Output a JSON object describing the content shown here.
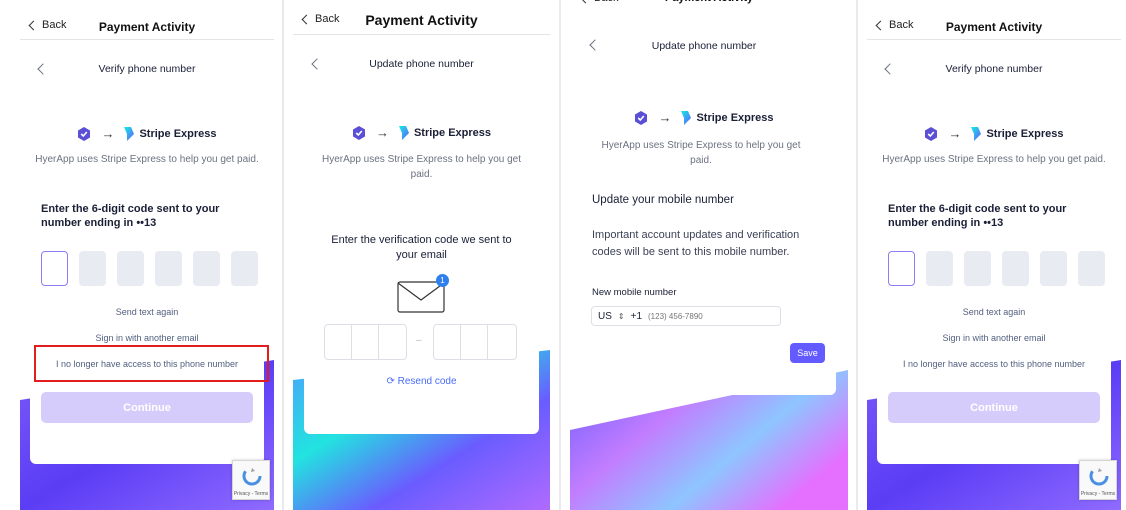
{
  "nav": {
    "back_label": "Back",
    "title": "Payment Activity"
  },
  "brand": {
    "name": "Stripe Express",
    "arrow": "→",
    "description": "HyerApp uses Stripe Express to help you get paid."
  },
  "verify": {
    "title": "Verify phone number",
    "heading": "Enter the 6-digit code sent to your number ending in ••13",
    "send_again": "Send text again",
    "sign_in_other": "Sign in with another email",
    "no_access": "I no longer have access to this phone number",
    "continue_label": "Continue"
  },
  "update_email": {
    "title": "Update phone number",
    "prompt": "Enter the verification code we sent to your email",
    "badge": "1",
    "dash": "–",
    "resend_label": "Resend code",
    "resend_icon": "⟳"
  },
  "update_phone": {
    "title": "Update phone number",
    "heading": "Update your mobile number",
    "info": "Important account updates and verification codes will be sent to this mobile number.",
    "field_label": "New mobile number",
    "country": "US",
    "dial_code": "+1",
    "placeholder": "(123) 456-7890",
    "save_label": "Save"
  },
  "recaptcha": {
    "text": "Privacy - Terms"
  },
  "colors": {
    "accent": "#635bff",
    "highlight_box": "#e11d1d",
    "disabled_button": "#d5ccfb"
  }
}
